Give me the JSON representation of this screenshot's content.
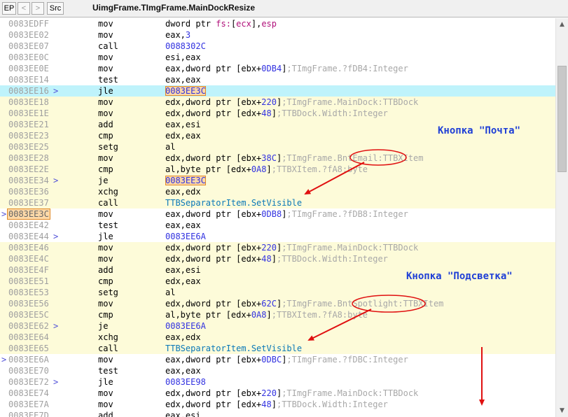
{
  "toolbar": {
    "ep": "EP",
    "back": "<",
    "forward": ">",
    "src": "Src",
    "title": "UimgFrame.TImgFrame.MainDockResize"
  },
  "annotations": {
    "email": "Кнопка \"Почта\"",
    "spotlight": "Кнопка \"Подсветка\""
  },
  "colors": {
    "selected_row": "#bff3fb",
    "block_row": "#fdfbd9",
    "annotation_text": "#1f3fd6",
    "arrow": "#e01010"
  },
  "rows": [
    {
      "addr": "0083EDFF",
      "mn": "mov",
      "ops": [
        {
          "t": "dword ptr "
        },
        {
          "t": "fs:",
          "c": "kw"
        },
        {
          "t": "["
        },
        {
          "t": "ecx",
          "c": "kw"
        },
        {
          "t": "],"
        },
        {
          "t": "esp",
          "c": "kw"
        }
      ]
    },
    {
      "addr": "0083EE02",
      "mn": "mov",
      "ops": [
        {
          "t": "eax,"
        },
        {
          "t": "3",
          "c": "num"
        }
      ]
    },
    {
      "addr": "0083EE07",
      "mn": "call",
      "ops": [
        {
          "t": "0088302C",
          "c": "num"
        }
      ]
    },
    {
      "addr": "0083EE0C",
      "mn": "mov",
      "ops": [
        {
          "t": "esi,eax"
        }
      ]
    },
    {
      "addr": "0083EE0E",
      "mn": "mov",
      "ops": [
        {
          "t": "eax,dword ptr [ebx+"
        },
        {
          "t": "0DB4",
          "c": "num"
        },
        {
          "t": "]"
        },
        {
          "t": ";TImgFrame.?fDB4:Integer",
          "c": "cmt"
        }
      ]
    },
    {
      "addr": "0083EE14",
      "mn": "test",
      "ops": [
        {
          "t": "eax,eax"
        }
      ]
    },
    {
      "addr": "0083EE16",
      "jm": ">",
      "mn": "jle",
      "bg": "sel",
      "ops": [
        {
          "t": "0083EE3C",
          "c": "lbl"
        }
      ]
    },
    {
      "addr": "0083EE18",
      "mn": "mov",
      "bg": "blk",
      "ops": [
        {
          "t": "edx,dword ptr [ebx+"
        },
        {
          "t": "220",
          "c": "num"
        },
        {
          "t": "]"
        },
        {
          "t": ";TImgFrame.MainDock:TTBDock",
          "c": "cmt"
        }
      ]
    },
    {
      "addr": "0083EE1E",
      "mn": "mov",
      "bg": "blk",
      "ops": [
        {
          "t": "edx,dword ptr [edx+"
        },
        {
          "t": "48",
          "c": "num"
        },
        {
          "t": "]"
        },
        {
          "t": ";TTBDock.Width:Integer",
          "c": "cmt"
        }
      ]
    },
    {
      "addr": "0083EE21",
      "mn": "add",
      "bg": "blk",
      "ops": [
        {
          "t": "eax,esi"
        }
      ]
    },
    {
      "addr": "0083EE23",
      "mn": "cmp",
      "bg": "blk",
      "ops": [
        {
          "t": "edx,eax"
        }
      ]
    },
    {
      "addr": "0083EE25",
      "mn": "setg",
      "bg": "blk",
      "ops": [
        {
          "t": "al"
        }
      ]
    },
    {
      "addr": "0083EE28",
      "mn": "mov",
      "bg": "blk",
      "ops": [
        {
          "t": "edx,dword ptr [ebx+"
        },
        {
          "t": "38C",
          "c": "num"
        },
        {
          "t": "]"
        },
        {
          "t": ";TImgFrame.BntEmail:TTBXItem",
          "c": "cmt"
        }
      ]
    },
    {
      "addr": "0083EE2E",
      "mn": "cmp",
      "bg": "blk",
      "ops": [
        {
          "t": "al,byte ptr [edx+"
        },
        {
          "t": "0A8",
          "c": "num"
        },
        {
          "t": "]"
        },
        {
          "t": ";TTBXItem.?fA8:byte",
          "c": "cmt"
        }
      ]
    },
    {
      "addr": "0083EE34",
      "jm": ">",
      "mn": "je",
      "bg": "blk",
      "ops": [
        {
          "t": "0083EE3C",
          "c": "lbl"
        }
      ]
    },
    {
      "addr": "0083EE36",
      "mn": "xchg",
      "bg": "blk",
      "ops": [
        {
          "t": "eax,edx"
        }
      ]
    },
    {
      "addr": "0083EE37",
      "mn": "call",
      "bg": "blk",
      "ops": [
        {
          "t": "TTBSeparatorItem.SetVisible",
          "c": "fn"
        }
      ]
    },
    {
      "addr": "0083EE3C",
      "lm": ">",
      "boxed": true,
      "mn": "mov",
      "ops": [
        {
          "t": "eax,dword ptr [ebx+"
        },
        {
          "t": "0DB8",
          "c": "num"
        },
        {
          "t": "]"
        },
        {
          "t": ";TImgFrame.?fDB8:Integer",
          "c": "cmt"
        }
      ]
    },
    {
      "addr": "0083EE42",
      "mn": "test",
      "ops": [
        {
          "t": "eax,eax"
        }
      ]
    },
    {
      "addr": "0083EE44",
      "jm": ">",
      "mn": "jle",
      "ops": [
        {
          "t": "0083EE6A",
          "c": "num"
        }
      ]
    },
    {
      "addr": "0083EE46",
      "mn": "mov",
      "bg": "blk",
      "ops": [
        {
          "t": "edx,dword ptr [ebx+"
        },
        {
          "t": "220",
          "c": "num"
        },
        {
          "t": "]"
        },
        {
          "t": ";TImgFrame.MainDock:TTBDock",
          "c": "cmt"
        }
      ]
    },
    {
      "addr": "0083EE4C",
      "mn": "mov",
      "bg": "blk",
      "ops": [
        {
          "t": "edx,dword ptr [edx+"
        },
        {
          "t": "48",
          "c": "num"
        },
        {
          "t": "]"
        },
        {
          "t": ";TTBDock.Width:Integer",
          "c": "cmt"
        }
      ]
    },
    {
      "addr": "0083EE4F",
      "mn": "add",
      "bg": "blk",
      "ops": [
        {
          "t": "eax,esi"
        }
      ]
    },
    {
      "addr": "0083EE51",
      "mn": "cmp",
      "bg": "blk",
      "ops": [
        {
          "t": "edx,eax"
        }
      ]
    },
    {
      "addr": "0083EE53",
      "mn": "setg",
      "bg": "blk",
      "ops": [
        {
          "t": "al"
        }
      ]
    },
    {
      "addr": "0083EE56",
      "mn": "mov",
      "bg": "blk",
      "ops": [
        {
          "t": "edx,dword ptr [ebx+"
        },
        {
          "t": "62C",
          "c": "num"
        },
        {
          "t": "]"
        },
        {
          "t": ";TImgFrame.BntSpotlight:TTBXItem",
          "c": "cmt"
        }
      ]
    },
    {
      "addr": "0083EE5C",
      "mn": "cmp",
      "bg": "blk",
      "ops": [
        {
          "t": "al,byte ptr [edx+"
        },
        {
          "t": "0A8",
          "c": "num"
        },
        {
          "t": "]"
        },
        {
          "t": ";TTBXItem.?fA8:byte",
          "c": "cmt"
        }
      ]
    },
    {
      "addr": "0083EE62",
      "jm": ">",
      "mn": "je",
      "bg": "blk",
      "ops": [
        {
          "t": "0083EE6A",
          "c": "num"
        }
      ]
    },
    {
      "addr": "0083EE64",
      "mn": "xchg",
      "bg": "blk",
      "ops": [
        {
          "t": "eax,edx"
        }
      ]
    },
    {
      "addr": "0083EE65",
      "mn": "call",
      "bg": "blk",
      "ops": [
        {
          "t": "TTBSeparatorItem.SetVisible",
          "c": "fn"
        }
      ]
    },
    {
      "addr": "0083EE6A",
      "lm": ">",
      "mn": "mov",
      "ops": [
        {
          "t": "eax,dword ptr [ebx+"
        },
        {
          "t": "0DBC",
          "c": "num"
        },
        {
          "t": "]"
        },
        {
          "t": ";TImgFrame.?fDBC:Integer",
          "c": "cmt"
        }
      ]
    },
    {
      "addr": "0083EE70",
      "mn": "test",
      "ops": [
        {
          "t": "eax,eax"
        }
      ]
    },
    {
      "addr": "0083EE72",
      "jm": ">",
      "mn": "jle",
      "ops": [
        {
          "t": "0083EE98",
          "c": "num"
        }
      ]
    },
    {
      "addr": "0083EE74",
      "mn": "mov",
      "ops": [
        {
          "t": "edx,dword ptr [ebx+"
        },
        {
          "t": "220",
          "c": "num"
        },
        {
          "t": "]"
        },
        {
          "t": ";TImgFrame.MainDock:TTBDock",
          "c": "cmt"
        }
      ]
    },
    {
      "addr": "0083EE7A",
      "mn": "mov",
      "ops": [
        {
          "t": "edx,dword ptr [edx+"
        },
        {
          "t": "48",
          "c": "num"
        },
        {
          "t": "]"
        },
        {
          "t": ";TTBDock.Width:Integer",
          "c": "cmt"
        }
      ]
    },
    {
      "addr": "0083EE7D",
      "mn": "add",
      "ops": [
        {
          "t": "eax,esi"
        }
      ]
    }
  ]
}
